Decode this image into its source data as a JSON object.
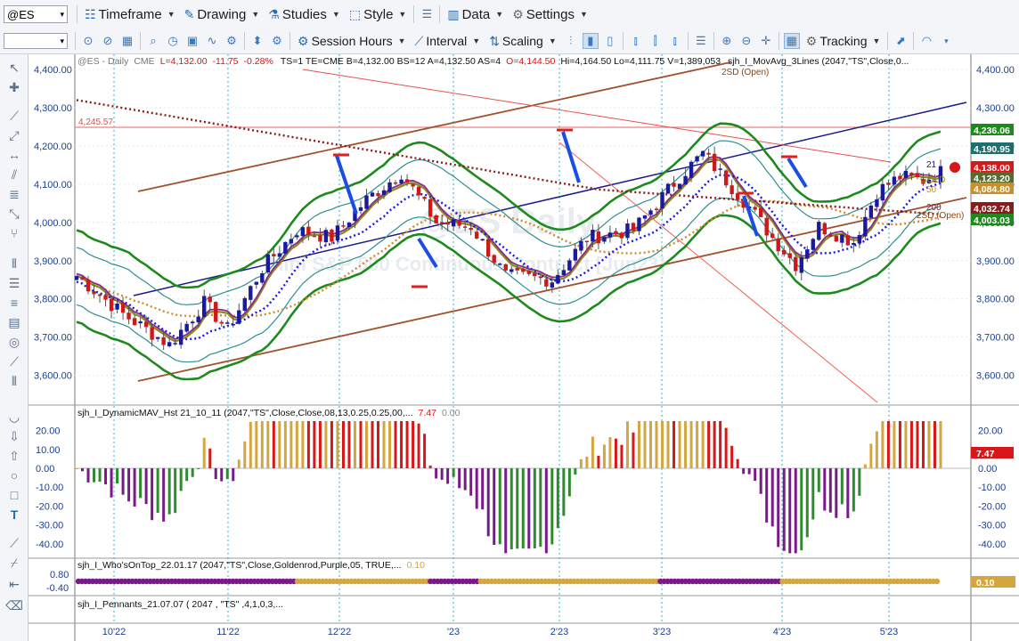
{
  "toolbar1": {
    "symbol": "@ES",
    "timeframe": "Timeframe",
    "drawing": "Drawing",
    "studies": "Studies",
    "style": "Style",
    "data": "Data",
    "settings": "Settings"
  },
  "toolbar2": {
    "session_hours": "Session Hours",
    "interval": "Interval",
    "scaling": "Scaling",
    "tracking": "Tracking"
  },
  "chart": {
    "header_prefix": "@ES - Daily",
    "exchange": "CME",
    "last": "L=4,132.00",
    "change": "-11.75",
    "pct": "-0.28%",
    "quote_info": "TS=1  TE=CME  B=4,132.00  BS=12  A=4,132.50  AS=4",
    "open": "O=4,144.50",
    "hi_lo": "Hi=4,164.50   Lo=4,111.75   V=1,389,053",
    "study_label": "sjh_I_MovAvg_3Lines (2047,\"TS\",Close,0...",
    "label_2sd_top": "2SD (Open)",
    "label_2sd_bottom": "2SD (Open)",
    "label_4245": "4,245.57",
    "label_gold": "GOLD",
    "label_50": "50",
    "label_200": "200",
    "label_21": "21",
    "watermark1": "@ES Daily",
    "watermark2": "Mini S&P 500 Continuous Contract [Jun23]",
    "price_ticks": [
      "4,400.00",
      "4,300.00",
      "4,200.00",
      "4,100.00",
      "4,000.00",
      "3,900.00",
      "3,800.00",
      "3,700.00",
      "3,600.00"
    ],
    "right_tags": [
      {
        "text": "4,236.06",
        "color": "#1e8a1e"
      },
      {
        "text": "4,190.95",
        "color": "#1f6f6f"
      },
      {
        "text": "4,138.00",
        "color": "#d81818"
      },
      {
        "text": "4,123.20",
        "color": "#556b2f"
      },
      {
        "text": "4,084.80",
        "color": "#c8902a"
      },
      {
        "text": "4,032.74",
        "color": "#8b1a1a"
      },
      {
        "text": "4,003.03",
        "color": "#1e8a1e"
      }
    ],
    "date_labels": [
      "10'22",
      "11'22",
      "12'22",
      "'23",
      "2'23",
      "3'23",
      "4'23",
      "5'23"
    ]
  },
  "indicator1": {
    "label": "sjh_I_DynamicMAV_Hst 21_10_11 (2047,\"TS\",Close,Close,08,13,0.25,0.25,00,...",
    "v1": "7.47",
    "v2": "0.00",
    "ticks": [
      "20.00",
      "0.00",
      "-20.00",
      "-40.00"
    ],
    "right_ticks": [
      "20.00",
      "0.00",
      "-10.00",
      "-20.00",
      "-30.00",
      "-40.00"
    ],
    "left_ticks_full": [
      "20.00",
      "10.00",
      "0.00",
      "-10.00",
      "-20.00",
      "-30.00",
      "-40.00"
    ],
    "right_tag": "7.47",
    "right_tag_zero": "0.00"
  },
  "indicator2": {
    "label": "sjh_I_Who'sOnTop_22.01.17 (2047,\"TS\",Close,Goldenrod,Purple,05, TRUE,...",
    "value": "0.10",
    "ticks": [
      "0.80",
      "-0.40"
    ],
    "right_tag": "0.10"
  },
  "indicator3": {
    "label": "sjh_I_Pennants_21.07.07 ( 2047 , \"TS\" ,4,1,0,3,..."
  },
  "colors": {
    "accent": "#2a6ab0",
    "up_bar": "#1a1aa0",
    "down_bar": "#d01818",
    "hist_green": "#2e8b2e",
    "hist_purple": "#7a1a8a",
    "hist_gold": "#d4a640",
    "hist_red": "#d81818"
  }
}
